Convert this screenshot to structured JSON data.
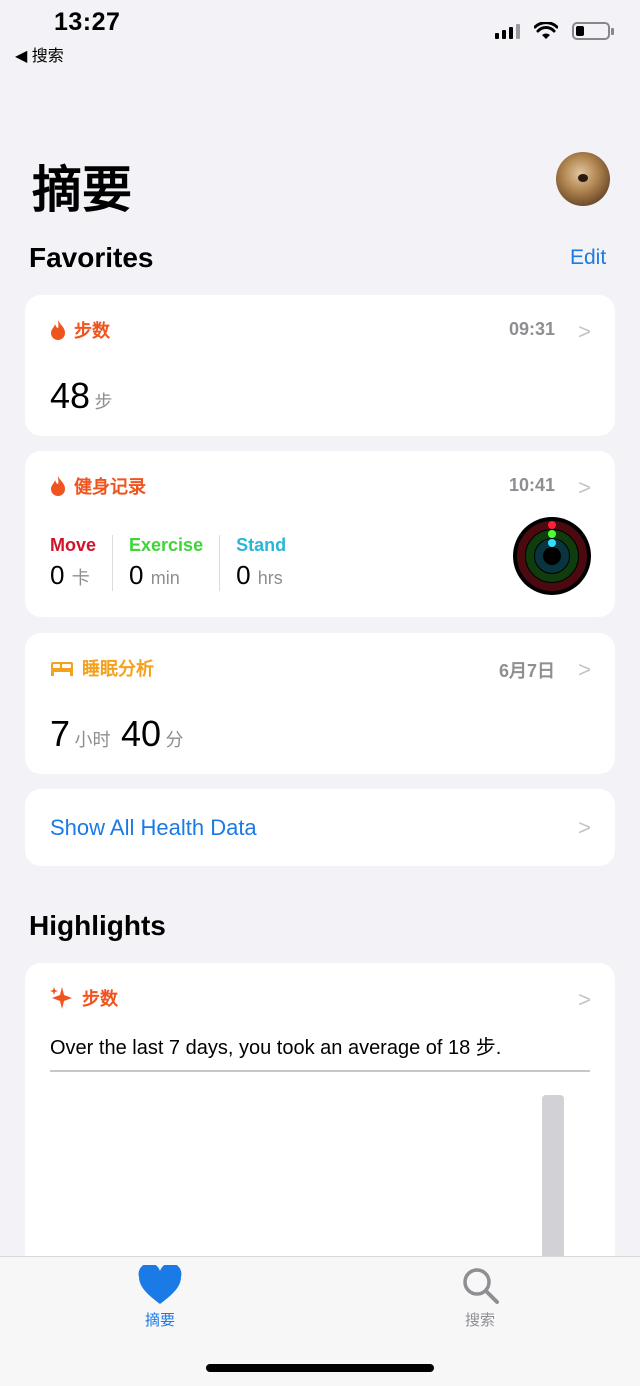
{
  "status": {
    "time": "13:27",
    "back_label": "◀ 搜索"
  },
  "page": {
    "title": "摘要"
  },
  "favorites": {
    "heading": "Favorites",
    "edit_label": "Edit",
    "steps": {
      "title": "步数",
      "time": "09:31",
      "value": "48",
      "unit": "步"
    },
    "fitness": {
      "title": "健身记录",
      "time": "10:41",
      "move_label": "Move",
      "move_value": "0",
      "move_unit": "卡",
      "exercise_label": "Exercise",
      "exercise_value": "0",
      "exercise_unit": "min",
      "stand_label": "Stand",
      "stand_value": "0",
      "stand_unit": "hrs"
    },
    "sleep": {
      "title": "睡眠分析",
      "date": "6月7日",
      "hours": "7",
      "hours_unit": "小时",
      "minutes": "40",
      "minutes_unit": "分"
    },
    "show_all_label": "Show All Health Data"
  },
  "highlights": {
    "heading": "Highlights",
    "card_title": "步数",
    "text": "Over the last 7 days, you took an average of 18 步."
  },
  "tabbar": {
    "summary_label": "摘要",
    "search_label": "搜索"
  },
  "colors": {
    "accent": "#1a7ae6",
    "orange": "#f0541e",
    "sleep": "#f4a11d",
    "move": "#d0142c",
    "exercise": "#3fd43a",
    "stand": "#2ab6d8"
  }
}
